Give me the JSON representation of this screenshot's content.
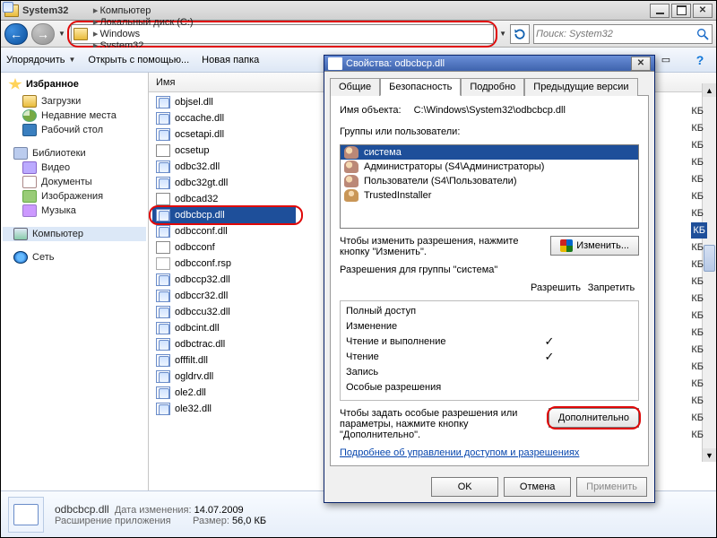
{
  "window": {
    "title": "System32",
    "minimize_label": "_",
    "restore_label": "",
    "close_label": "✕"
  },
  "breadcrumb": [
    "Компьютер",
    "Локальный диск (C:)",
    "Windows",
    "System32"
  ],
  "search": {
    "placeholder": "Поиск: System32"
  },
  "toolbar": {
    "organize": "Упорядочить",
    "openwith": "Открыть с помощью...",
    "newfolder": "Новая папка"
  },
  "tree": {
    "favorites": "Избранное",
    "fav_items": [
      {
        "icon": "ic-folder",
        "label": "Загрузки"
      },
      {
        "icon": "ic-recent",
        "label": "Недавние места"
      },
      {
        "icon": "ic-desktop",
        "label": "Рабочий стол"
      }
    ],
    "libraries": "Библиотеки",
    "lib_items": [
      {
        "icon": "ic-video",
        "label": "Видео"
      },
      {
        "icon": "ic-docs",
        "label": "Документы"
      },
      {
        "icon": "ic-images",
        "label": "Изображения"
      },
      {
        "icon": "ic-music",
        "label": "Музыка"
      }
    ],
    "computer": "Компьютер",
    "network": "Сеть"
  },
  "columns": {
    "name": "Имя"
  },
  "files": [
    {
      "name": "objsel.dll",
      "type": "dll"
    },
    {
      "name": "occache.dll",
      "type": "dll"
    },
    {
      "name": "ocsetapi.dll",
      "type": "dll"
    },
    {
      "name": "ocsetup",
      "type": "exe"
    },
    {
      "name": "odbc32.dll",
      "type": "dll"
    },
    {
      "name": "odbc32gt.dll",
      "type": "dll"
    },
    {
      "name": "odbcad32",
      "type": "exe"
    },
    {
      "name": "odbcbcp.dll",
      "type": "dll",
      "selected": true
    },
    {
      "name": "odbcconf.dll",
      "type": "dll"
    },
    {
      "name": "odbcconf",
      "type": "exe"
    },
    {
      "name": "odbcconf.rsp",
      "type": "rsp"
    },
    {
      "name": "odbccp32.dll",
      "type": "dll"
    },
    {
      "name": "odbccr32.dll",
      "type": "dll"
    },
    {
      "name": "odbccu32.dll",
      "type": "dll"
    },
    {
      "name": "odbcint.dll",
      "type": "dll"
    },
    {
      "name": "odbctrac.dll",
      "type": "dll"
    },
    {
      "name": "offfilt.dll",
      "type": "dll"
    },
    {
      "name": "ogldrv.dll",
      "type": "dll"
    },
    {
      "name": "ole2.dll",
      "type": "dll"
    },
    {
      "name": "ole32.dll",
      "type": "dll"
    }
  ],
  "kb_suffix": "КБ",
  "status": {
    "file": "odbcbcp.dll",
    "mlabel": "Дата изменения:",
    "mval": "14.07.2009",
    "desc": "Расширение приложения",
    "slabel": "Размер:",
    "sval": "56,0 КБ"
  },
  "props": {
    "title": "Свойства: odbcbcp.dll",
    "tabs": [
      "Общие",
      "Безопасность",
      "Подробно",
      "Предыдущие версии"
    ],
    "active_tab": 1,
    "obj_label": "Имя объекта:",
    "obj_value": "C:\\Windows\\System32\\odbcbcp.dll",
    "groups_label": "Группы или пользователи:",
    "groups": [
      {
        "name": "система",
        "selected": true,
        "multi": true
      },
      {
        "name": "Администраторы (S4\\Администраторы)",
        "multi": true
      },
      {
        "name": "Пользователи (S4\\Пользователи)",
        "multi": true
      },
      {
        "name": "TrustedInstaller",
        "multi": false
      }
    ],
    "change_hint": "Чтобы изменить разрешения, нажмите кнопку \"Изменить\".",
    "change_btn": "Изменить...",
    "perm_caption": "Разрешения для группы \"система\"",
    "perm_allow": "Разрешить",
    "perm_deny": "Запретить",
    "perms": [
      {
        "name": "Полный доступ",
        "allow": false
      },
      {
        "name": "Изменение",
        "allow": false
      },
      {
        "name": "Чтение и выполнение",
        "allow": true
      },
      {
        "name": "Чтение",
        "allow": true
      },
      {
        "name": "Запись",
        "allow": false
      },
      {
        "name": "Особые разрешения",
        "allow": false
      }
    ],
    "adv_hint": "Чтобы задать особые разрешения или параметры, нажмите кнопку \"Дополнительно\".",
    "adv_btn": "Дополнительно",
    "learn_link": "Подробнее об управлении доступом и разрешениях",
    "ok": "OK",
    "cancel": "Отмена",
    "apply": "Применить"
  }
}
